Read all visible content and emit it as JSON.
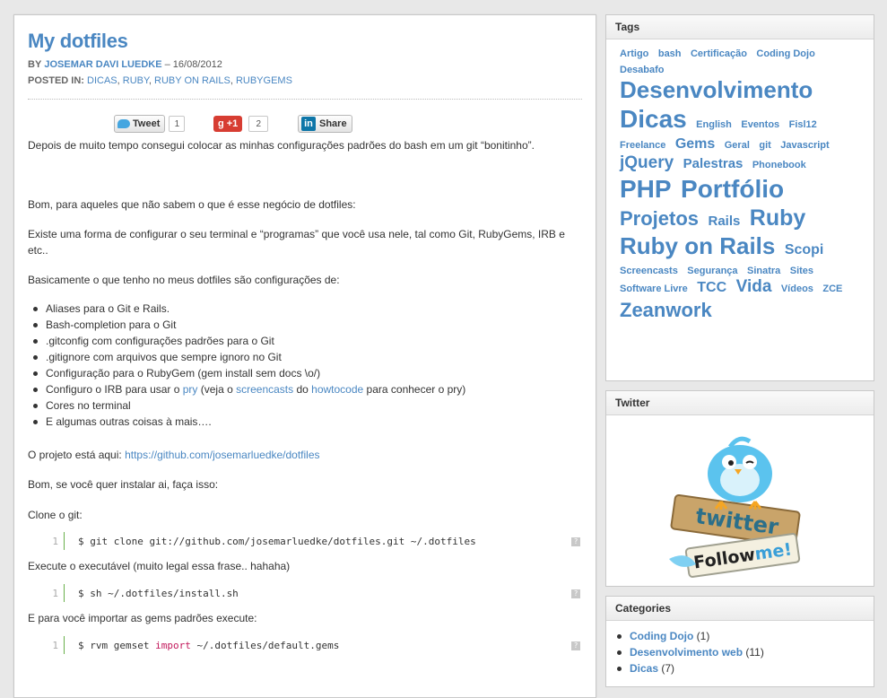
{
  "post": {
    "title": "My dotfiles",
    "by_label": "BY",
    "author": "JOSEMAR DAVI LUEDKE",
    "date": "– 16/08/2012",
    "posted_label": "POSTED IN:",
    "categories": [
      "DICAS",
      "RUBY",
      "RUBY ON RAILS",
      "RUBYGEMS"
    ],
    "share": {
      "tweet_label": "Tweet",
      "tweet_count": "1",
      "gplus_label": "+1",
      "gplus_count": "2",
      "linkedin_icon": "in",
      "linkedin_label": "Share"
    },
    "p1": "Depois de muito tempo consegui colocar as minhas configurações padrões do bash em um git “bonitinho”.",
    "p2": "Bom, para aqueles que não sabem o que é esse negócio de dotfiles:",
    "p3": "Existe uma forma de configurar o seu terminal e “programas” que você usa nele, tal como Git, RubyGems, IRB e etc..",
    "p4": "Basicamente o que tenho no meus dotfiles são configurações de:",
    "bullets": {
      "b1": "Aliases para o Git e Rails.",
      "b2": "Bash-completion para o Git",
      "b3": ".gitconfig com configurações padrões para o Git",
      "b4": ".gitignore com arquivos que sempre ignoro no Git",
      "b5": "Configuração para o RubyGem (gem install sem docs \\o/)",
      "b6_pre": "Configuro o IRB para usar o ",
      "b6_link1": "pry",
      "b6_mid1": " (veja o ",
      "b6_link2": "screencasts",
      "b6_mid2": " do ",
      "b6_link3": "howtocode",
      "b6_post": " para conhecer o pry)",
      "b7": "Cores no terminal",
      "b8": "E algumas outras coisas à mais…."
    },
    "p5_label": "O projeto está aqui: ",
    "p5_link": "https://github.com/josemarluedke/dotfiles",
    "p6": "Bom, se você quer instalar ai, faça isso:",
    "p7": "Clone o git:",
    "code1": {
      "line": "1",
      "text": "$ git clone git://github.com/josemarluedke/dotfiles.git ~/.dotfiles"
    },
    "p8": "Execute o executável (muito legal essa frase.. hahaha)",
    "code2": {
      "line": "1",
      "text": "$ sh ~/.dotfiles/install.sh"
    },
    "p9": "E para você importar as gems padrões execute:",
    "code3": {
      "line": "1",
      "pre": "$ rvm gemset ",
      "kw": "import",
      "post": " ~/.dotfiles/default.gems"
    },
    "code_help": "?"
  },
  "sidebar": {
    "tags_title": "Tags",
    "tags": [
      {
        "label": "Artigo",
        "size": 11
      },
      {
        "label": "bash",
        "size": 11
      },
      {
        "label": "Certificação",
        "size": 11
      },
      {
        "label": "Coding Dojo",
        "size": 11
      },
      {
        "label": "Desabafo",
        "size": 11
      },
      {
        "label": "Desenvolvimento",
        "size": 26
      },
      {
        "label": "Dicas",
        "size": 28
      },
      {
        "label": "English",
        "size": 11
      },
      {
        "label": "Eventos",
        "size": 11
      },
      {
        "label": "Fisl12",
        "size": 11
      },
      {
        "label": "Freelance",
        "size": 11
      },
      {
        "label": "Gems",
        "size": 16
      },
      {
        "label": "Geral",
        "size": 11
      },
      {
        "label": "git",
        "size": 11
      },
      {
        "label": "Javascript",
        "size": 11
      },
      {
        "label": "jQuery",
        "size": 19
      },
      {
        "label": "Palestras",
        "size": 15
      },
      {
        "label": "Phonebook",
        "size": 11
      },
      {
        "label": "PHP",
        "size": 28
      },
      {
        "label": "Portfólio",
        "size": 28
      },
      {
        "label": "Projetos",
        "size": 22
      },
      {
        "label": "Rails",
        "size": 15
      },
      {
        "label": "Ruby",
        "size": 25
      },
      {
        "label": "Ruby on Rails",
        "size": 26
      },
      {
        "label": "Scopi",
        "size": 16
      },
      {
        "label": "Screencasts",
        "size": 11
      },
      {
        "label": "Segurança",
        "size": 11
      },
      {
        "label": "Sinatra",
        "size": 11
      },
      {
        "label": "Sites",
        "size": 11
      },
      {
        "label": "Software Livre",
        "size": 11
      },
      {
        "label": "TCC",
        "size": 16
      },
      {
        "label": "Vida",
        "size": 19
      },
      {
        "label": "Vídeos",
        "size": 11
      },
      {
        "label": "ZCE",
        "size": 11
      },
      {
        "label": "Zeanwork",
        "size": 22
      }
    ],
    "twitter_title": "Twitter",
    "twitter_badge_top": "twitter",
    "twitter_badge_follow": "Follow",
    "twitter_badge_me": "me!",
    "categories_title": "Categories",
    "categories": [
      {
        "label": "Coding Dojo",
        "count": "(1)"
      },
      {
        "label": "Desenvolvimento web",
        "count": "(11)"
      },
      {
        "label": "Dicas",
        "count": "(7)"
      }
    ]
  }
}
